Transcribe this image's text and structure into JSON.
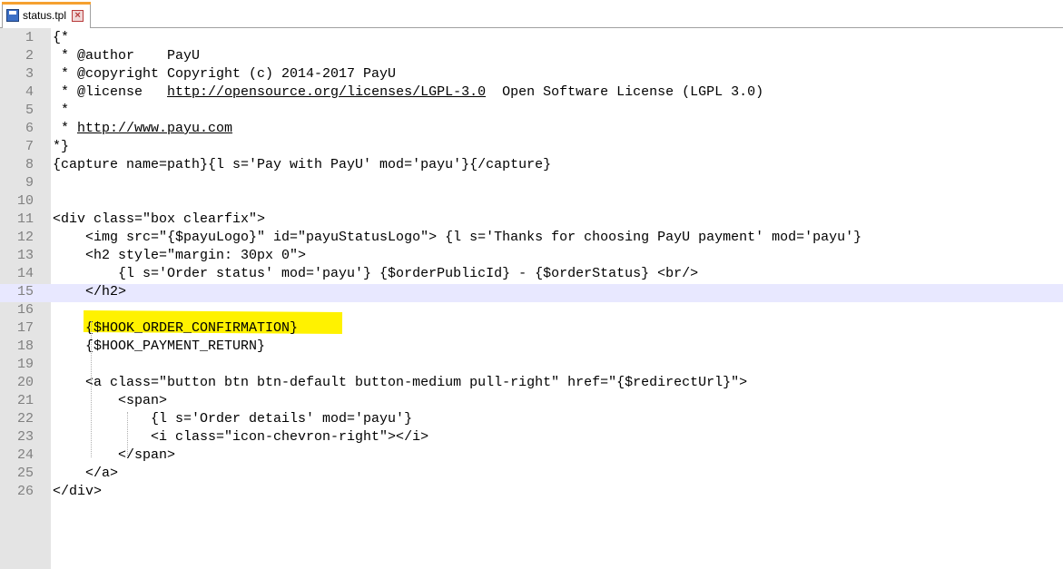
{
  "tab": {
    "title": "status.tpl",
    "close_glyph": "×"
  },
  "editor": {
    "current_line": 15,
    "highlight_color": "#fff200",
    "lines": [
      {
        "n": "1",
        "t": "{*"
      },
      {
        "n": "2",
        "t": " * @author    PayU"
      },
      {
        "n": "3",
        "t": " * @copyright Copyright (c) 2014-2017 PayU"
      },
      {
        "n": "4",
        "t": " * @license   http://opensource.org/licenses/LGPL-3.0  Open Software License (LGPL 3.0)"
      },
      {
        "n": "5",
        "t": " *"
      },
      {
        "n": "6",
        "t": " * http://www.payu.com"
      },
      {
        "n": "7",
        "t": "*}"
      },
      {
        "n": "8",
        "t": "{capture name=path}{l s='Pay with PayU' mod='payu'}{/capture}"
      },
      {
        "n": "9",
        "t": ""
      },
      {
        "n": "10",
        "t": ""
      },
      {
        "n": "11",
        "t": "<div class=\"box clearfix\">"
      },
      {
        "n": "12",
        "t": "    <img src=\"{$payuLogo}\" id=\"payuStatusLogo\"> {l s='Thanks for choosing PayU payment' mod='payu'}"
      },
      {
        "n": "13",
        "t": "    <h2 style=\"margin: 30px 0\">"
      },
      {
        "n": "14",
        "t": "        {l s='Order status' mod='payu'} {$orderPublicId} - {$orderStatus} <br/>"
      },
      {
        "n": "15",
        "t": "    </h2>"
      },
      {
        "n": "16",
        "t": ""
      },
      {
        "n": "17",
        "t": "    {$HOOK_ORDER_CONFIRMATION}"
      },
      {
        "n": "18",
        "t": "    {$HOOK_PAYMENT_RETURN}"
      },
      {
        "n": "19",
        "t": ""
      },
      {
        "n": "20",
        "t": "    <a class=\"button btn btn-default button-medium pull-right\" href=\"{$redirectUrl}\">"
      },
      {
        "n": "21",
        "t": "        <span>"
      },
      {
        "n": "22",
        "t": "            {l s='Order details' mod='payu'}"
      },
      {
        "n": "23",
        "t": "            <i class=\"icon-chevron-right\"></i>"
      },
      {
        "n": "24",
        "t": "        </span>"
      },
      {
        "n": "25",
        "t": "    </a>"
      },
      {
        "n": "26",
        "t": "</div>"
      }
    ]
  }
}
